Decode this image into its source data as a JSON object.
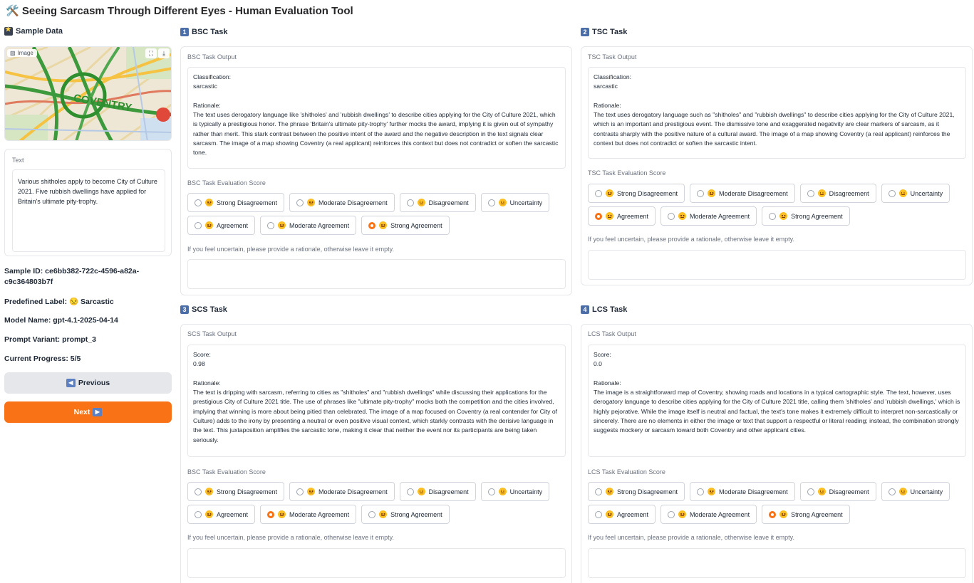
{
  "app": {
    "title": "🛠️ Seeing Sarcasm Through Different Eyes - Human Evaluation Tool"
  },
  "sample": {
    "heading": "Sample Data",
    "image_label": "Image",
    "text_label": "Text",
    "text": "Various shitholes apply to become City of Culture 2021. Five rubbish dwellings have applied for Britain's ultimate pity-trophy.",
    "map_label": "COVENTRY"
  },
  "meta": {
    "sample_id": "Sample ID: ce6bb382-722c-4596-a82a-c9c364803b7f",
    "predefined_label": "Predefined Label: 😒 Sarcastic",
    "model_name": "Model Name: gpt-4.1-2025-04-14",
    "prompt_variant": "Prompt Variant: prompt_3",
    "current_progress": "Current Progress: 5/5"
  },
  "nav": {
    "previous_label": "Previous",
    "next_label": "Next",
    "previous_arrow": "◀",
    "next_arrow": "▶"
  },
  "hint_text": "If you feel uncertain, please provide a rationale, otherwise leave it empty.",
  "options": [
    "Strong Disagreement",
    "Moderate Disagreement",
    "Disagreement",
    "Uncertainty",
    "Agreement",
    "Moderate Agreement",
    "Strong Agreement"
  ],
  "tasks": {
    "bsc": {
      "num": "1",
      "title": "BSC Task",
      "output_label": "BSC Task Output",
      "score_label": "BSC Task Evaluation Score",
      "line1": "Classification:",
      "line2": "sarcastic",
      "line3": "Rationale:",
      "rationale": "The text uses derogatory language like 'shitholes' and 'rubbish dwellings' to describe cities applying for the City of Culture 2021, which is typically a prestigious honor. The phrase 'Britain's ultimate pity-trophy' further mocks the award, implying it is given out of sympathy rather than merit. This stark contrast between the positive intent of the award and the negative description in the text signals clear sarcasm. The image of a map showing Coventry (a real applicant) reinforces this context but does not contradict or soften the sarcastic tone.",
      "selected": "Strong Agreement"
    },
    "tsc": {
      "num": "2",
      "title": "TSC Task",
      "output_label": "TSC Task Output",
      "score_label": "TSC Task Evaluation Score",
      "line1": "Classification:",
      "line2": "sarcastic",
      "line3": "Rationale:",
      "rationale": "The text uses derogatory language such as \"shitholes\" and \"rubbish dwellings\" to describe cities applying for the City of Culture 2021, which is an important and prestigious event. The dismissive tone and exaggerated negativity are clear markers of sarcasm, as it contrasts sharply with the positive nature of a cultural award. The image of a map showing Coventry (a real applicant) reinforces the context but does not contradict or soften the sarcastic intent.",
      "selected": "Agreement"
    },
    "scs": {
      "num": "3",
      "title": "SCS Task",
      "output_label": "SCS Task Output",
      "score_label": "BSC Task Evaluation Score",
      "line1": "Score:",
      "line2": "0.98",
      "line3": "Rationale:",
      "rationale": "The text is dripping with sarcasm, referring to cities as \"shitholes\" and \"rubbish dwellings\" while discussing their applications for the prestigious City of Culture 2021 title. The use of phrases like \"ultimate pity-trophy\" mocks both the competition and the cities involved, implying that winning is more about being pitied than celebrated. The image of a map focused on Coventry (a real contender for City of Culture) adds to the irony by presenting a neutral or even positive visual context, which starkly contrasts with the derisive language in the text. This juxtaposition amplifies the sarcastic tone, making it clear that neither the event nor its participants are being taken seriously.",
      "selected": "Moderate Agreement"
    },
    "lcs": {
      "num": "4",
      "title": "LCS Task",
      "output_label": "LCS Task Output",
      "score_label": "LCS Task Evaluation Score",
      "line1": "Score:",
      "line2": "0.0",
      "line3": "Rationale:",
      "rationale": "The image is a straightforward map of Coventry, showing roads and locations in a typical cartographic style. The text, however, uses derogatory language to describe cities applying for the City of Culture 2021 title, calling them 'shitholes' and 'rubbish dwellings,' which is highly pejorative. While the image itself is neutral and factual, the text's tone makes it extremely difficult to interpret non-sarcastically or sincerely. There are no elements in either the image or text that support a respectful or literal reading; instead, the combination strongly suggests mockery or sarcasm toward both Coventry and other applicant cities.",
      "selected": "Strong Agreement"
    }
  },
  "colors": {
    "accent": "#f97316",
    "badge": "#4b6ea8",
    "border": "#e5e7eb"
  }
}
